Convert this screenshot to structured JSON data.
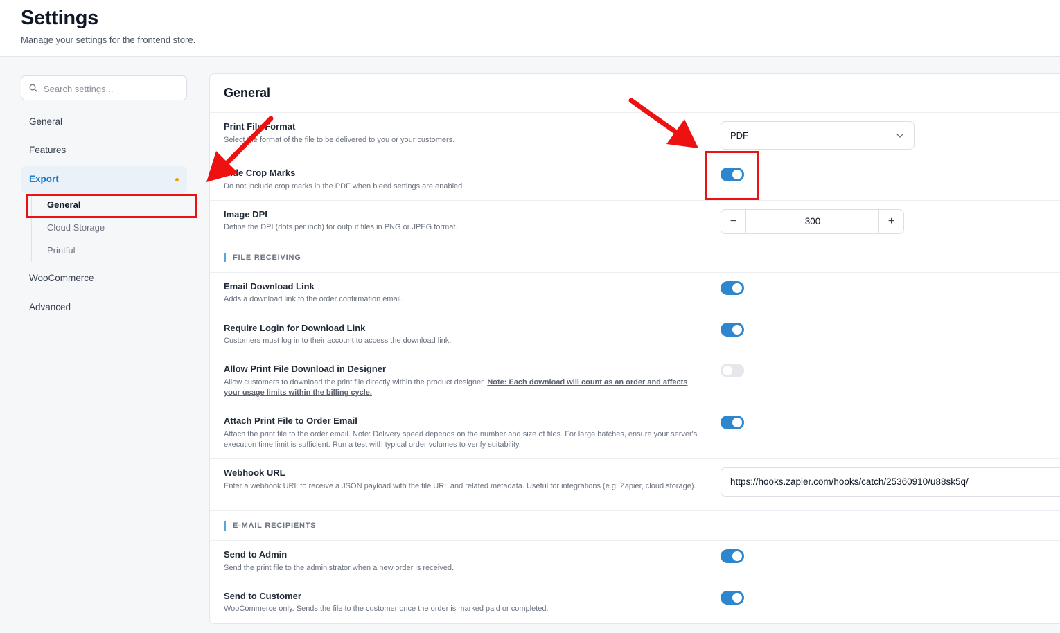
{
  "header": {
    "title": "Settings",
    "subtitle": "Manage your settings for the frontend store."
  },
  "search": {
    "placeholder": "Search settings..."
  },
  "sidebar": {
    "items": [
      {
        "label": "General"
      },
      {
        "label": "Features"
      },
      {
        "label": "Export"
      },
      {
        "label": "WooCommerce"
      },
      {
        "label": "Advanced"
      }
    ],
    "export_subitems": [
      {
        "label": "General"
      },
      {
        "label": "Cloud Storage"
      },
      {
        "label": "Printful"
      }
    ]
  },
  "panel": {
    "title": "General",
    "print_file_format": {
      "title": "Print File Format",
      "desc": "Select the format of the file to be delivered to you or your customers.",
      "value": "PDF"
    },
    "hide_crop_marks": {
      "title": "Hide Crop Marks",
      "desc": "Do not include crop marks in the PDF when bleed settings are enabled.",
      "enabled": true
    },
    "image_dpi": {
      "title": "Image DPI",
      "desc": "Define the DPI (dots per inch) for output files in PNG or JPEG format.",
      "value": "300",
      "minus": "−",
      "plus": "+"
    },
    "section_file_receiving": "FILE RECEIVING",
    "email_download_link": {
      "title": "Email Download Link",
      "desc": "Adds a download link to the order confirmation email.",
      "enabled": true
    },
    "require_login": {
      "title": "Require Login for Download Link",
      "desc": "Customers must log in to their account to access the download link.",
      "enabled": true
    },
    "allow_print_download": {
      "title": "Allow Print File Download in Designer",
      "desc": "Allow customers to download the print file directly within the product designer.",
      "note": "Note: Each download will count as an order and affects your usage limits within the billing cycle.",
      "enabled": false
    },
    "attach_print_file": {
      "title": "Attach Print File to Order Email",
      "desc": "Attach the print file to the order email. Note: Delivery speed depends on the number and size of files. For large batches, ensure your server's execution time limit is sufficient. Run a test with typical order volumes to verify suitability.",
      "enabled": true
    },
    "webhook_url": {
      "title": "Webhook URL",
      "desc": "Enter a webhook URL to receive a JSON payload with the file URL and related metadata. Useful for integrations (e.g. Zapier, cloud storage).",
      "value": "https://hooks.zapier.com/hooks/catch/25360910/u88sk5q/"
    },
    "section_email_recipients": "E-MAIL RECIPIENTS",
    "send_to_admin": {
      "title": "Send to Admin",
      "desc": "Send the print file to the administrator when a new order is received.",
      "enabled": true
    },
    "send_to_customer": {
      "title": "Send to Customer",
      "desc": "WooCommerce only. Sends the file to the customer once the order is marked paid or completed.",
      "enabled": true
    }
  },
  "colors": {
    "accent": "#2e86cf",
    "annotation_red": "#ee1111",
    "export_dot": "#e8a200"
  }
}
